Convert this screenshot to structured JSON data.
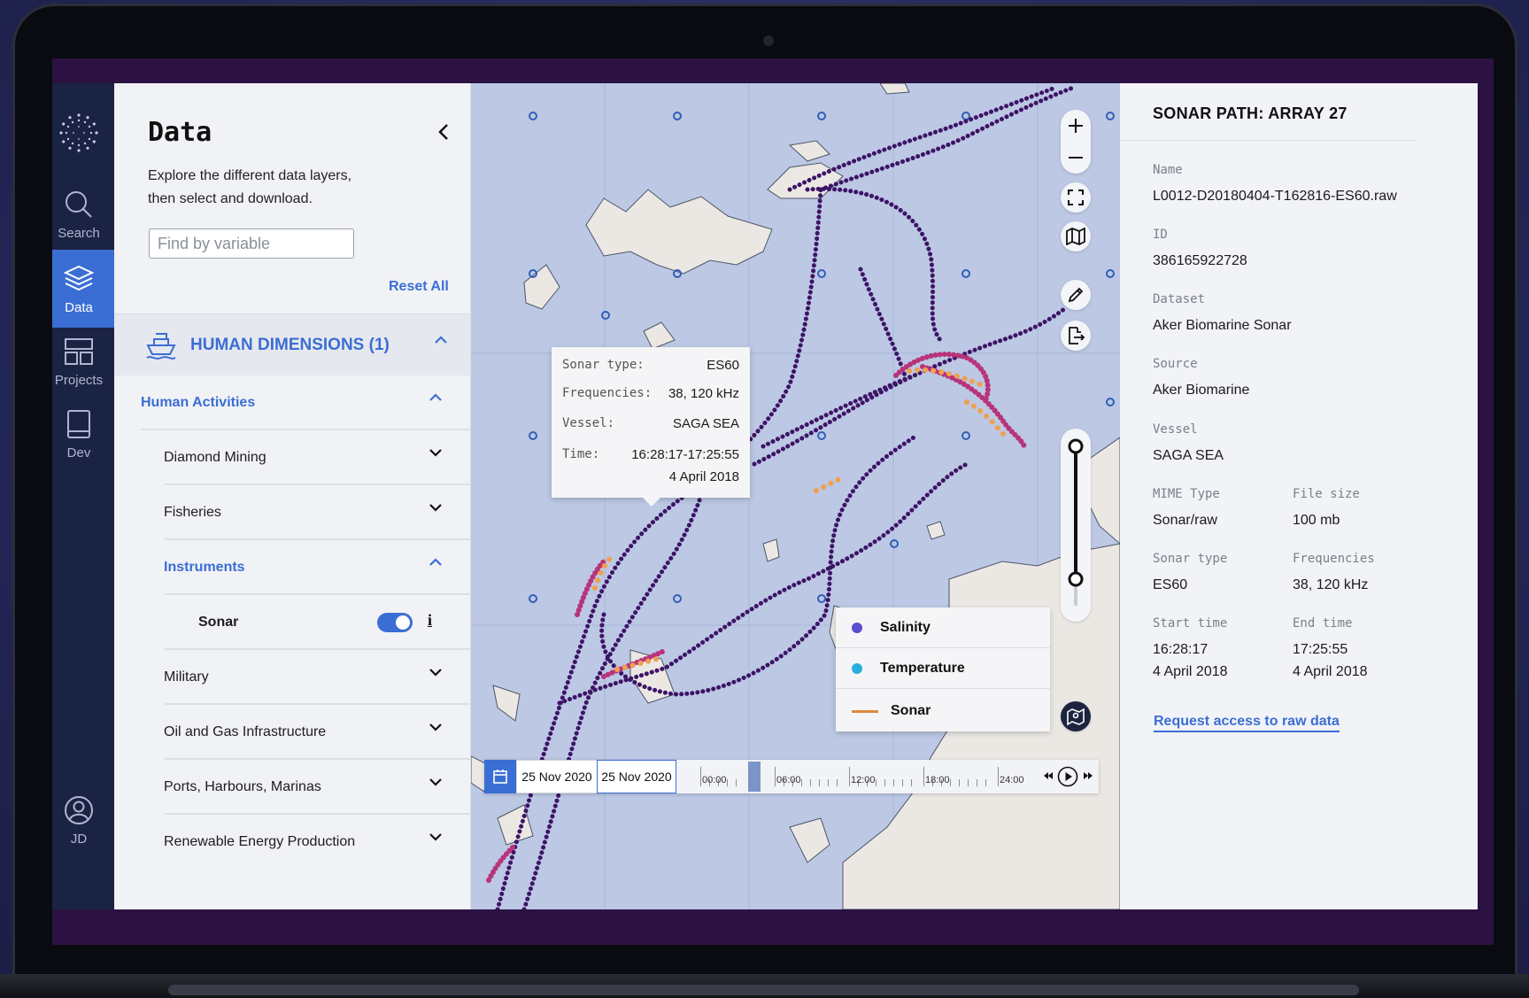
{
  "nav": {
    "items": [
      {
        "label": "Search"
      },
      {
        "label": "Data"
      },
      {
        "label": "Projects"
      },
      {
        "label": "Dev"
      }
    ],
    "user": "JD"
  },
  "data_panel": {
    "title": "Data",
    "description": "Explore the different data layers, then select and download.",
    "search_placeholder": "Find by variable",
    "reset_label": "Reset All",
    "section": {
      "label": "HUMAN DIMENSIONS (1)",
      "icon": "ship-icon"
    },
    "categories": [
      {
        "label": "Human Activities"
      },
      {
        "label": "Diamond Mining"
      },
      {
        "label": "Fisheries"
      },
      {
        "label": "Instruments"
      },
      {
        "label": "Sonar",
        "enabled": true,
        "info": "i"
      },
      {
        "label": "Military"
      },
      {
        "label": "Oil and Gas Infrastructure"
      },
      {
        "label": "Ports, Harbours, Marinas"
      },
      {
        "label": "Renewable Energy Production"
      }
    ]
  },
  "map": {
    "tooltip": {
      "rows": [
        {
          "key": "Sonar type:",
          "value": "ES60"
        },
        {
          "key": "Frequencies:",
          "value": "38, 120  kHz"
        },
        {
          "key": "Vessel:",
          "value": "SAGA SEA"
        },
        {
          "key": "Time:",
          "value": "16:28:17-17:25:55"
        },
        {
          "key": "",
          "value": "4 April 2018"
        }
      ]
    },
    "legend": [
      {
        "label": "Salinity",
        "color": "#5a4fcf"
      },
      {
        "label": "Temperature",
        "color": "#2aaee0"
      },
      {
        "label": "Sonar",
        "color": "#e08a3c"
      }
    ],
    "timeline": {
      "start_date": "25 Nov 2020",
      "end_date": "25 Nov 2020",
      "hours": [
        "00:00",
        "06:00",
        "12:00",
        "18:00",
        "24:00"
      ]
    },
    "colors": {
      "water": "#bcc8e4",
      "land": "#ebe8e4",
      "track_dark": "#3d1466",
      "track_mid": "#b8347a",
      "track_hot": "#f0a050"
    }
  },
  "detail": {
    "title": "SONAR PATH: ARRAY 27",
    "fields": {
      "name": {
        "label": "Name",
        "value": "L0012-D20180404-T162816-ES60.raw"
      },
      "id": {
        "label": "ID",
        "value": "386165922728"
      },
      "dataset": {
        "label": "Dataset",
        "value": "Aker Biomarine Sonar"
      },
      "source": {
        "label": "Source",
        "value": "Aker Biomarine"
      },
      "vessel": {
        "label": "Vessel",
        "value": "SAGA SEA"
      },
      "mime": {
        "label": "MIME Type",
        "value": "Sonar/raw"
      },
      "filesize": {
        "label": "File size",
        "value": "100 mb"
      },
      "sonar_type": {
        "label": "Sonar type",
        "value": "ES60"
      },
      "frequencies": {
        "label": "Frequencies",
        "value": "38, 120  kHz"
      },
      "start_time": {
        "label": "Start time",
        "value": "16:28:17",
        "date": "4 April 2018"
      },
      "end_time": {
        "label": "End time",
        "value": "17:25:55",
        "date": "4 April 2018"
      }
    },
    "request_link": "Request access to raw data"
  }
}
